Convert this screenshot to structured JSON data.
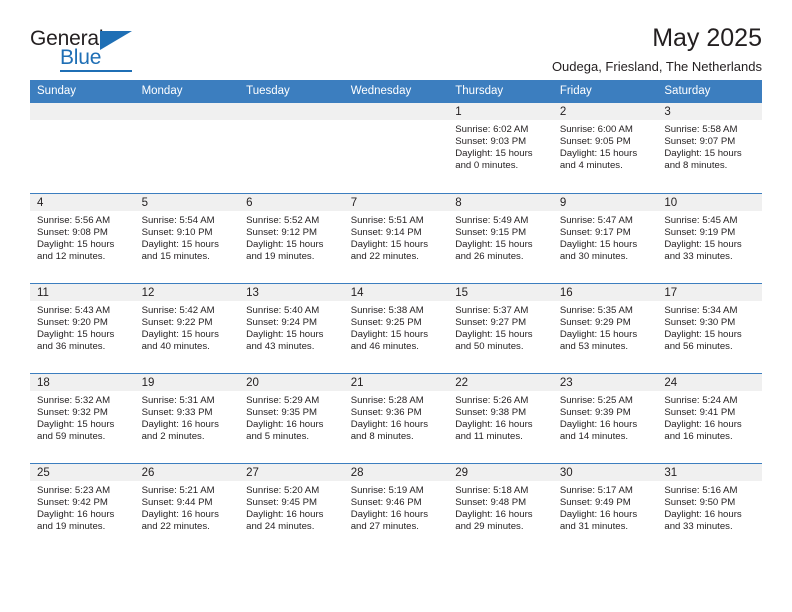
{
  "brand": {
    "name_top": "General",
    "name_bottom": "Blue",
    "accent_color": "#1f6fb5",
    "triangle_icon": "triangle-icon"
  },
  "header": {
    "title": "May 2025",
    "subtitle": "Oudega, Friesland, The Netherlands"
  },
  "calendar": {
    "header_background": "#3c7ebf",
    "daynum_background": "#f0f0f0",
    "weekday_headers": [
      "Sunday",
      "Monday",
      "Tuesday",
      "Wednesday",
      "Thursday",
      "Friday",
      "Saturday"
    ],
    "weeks": [
      [
        {
          "day": "",
          "sunrise": "",
          "sunset": "",
          "daylight_line1": "",
          "daylight_line2": ""
        },
        {
          "day": "",
          "sunrise": "",
          "sunset": "",
          "daylight_line1": "",
          "daylight_line2": ""
        },
        {
          "day": "",
          "sunrise": "",
          "sunset": "",
          "daylight_line1": "",
          "daylight_line2": ""
        },
        {
          "day": "",
          "sunrise": "",
          "sunset": "",
          "daylight_line1": "",
          "daylight_line2": ""
        },
        {
          "day": "1",
          "sunrise": "Sunrise: 6:02 AM",
          "sunset": "Sunset: 9:03 PM",
          "daylight_line1": "Daylight: 15 hours",
          "daylight_line2": "and 0 minutes."
        },
        {
          "day": "2",
          "sunrise": "Sunrise: 6:00 AM",
          "sunset": "Sunset: 9:05 PM",
          "daylight_line1": "Daylight: 15 hours",
          "daylight_line2": "and 4 minutes."
        },
        {
          "day": "3",
          "sunrise": "Sunrise: 5:58 AM",
          "sunset": "Sunset: 9:07 PM",
          "daylight_line1": "Daylight: 15 hours",
          "daylight_line2": "and 8 minutes."
        }
      ],
      [
        {
          "day": "4",
          "sunrise": "Sunrise: 5:56 AM",
          "sunset": "Sunset: 9:08 PM",
          "daylight_line1": "Daylight: 15 hours",
          "daylight_line2": "and 12 minutes."
        },
        {
          "day": "5",
          "sunrise": "Sunrise: 5:54 AM",
          "sunset": "Sunset: 9:10 PM",
          "daylight_line1": "Daylight: 15 hours",
          "daylight_line2": "and 15 minutes."
        },
        {
          "day": "6",
          "sunrise": "Sunrise: 5:52 AM",
          "sunset": "Sunset: 9:12 PM",
          "daylight_line1": "Daylight: 15 hours",
          "daylight_line2": "and 19 minutes."
        },
        {
          "day": "7",
          "sunrise": "Sunrise: 5:51 AM",
          "sunset": "Sunset: 9:14 PM",
          "daylight_line1": "Daylight: 15 hours",
          "daylight_line2": "and 22 minutes."
        },
        {
          "day": "8",
          "sunrise": "Sunrise: 5:49 AM",
          "sunset": "Sunset: 9:15 PM",
          "daylight_line1": "Daylight: 15 hours",
          "daylight_line2": "and 26 minutes."
        },
        {
          "day": "9",
          "sunrise": "Sunrise: 5:47 AM",
          "sunset": "Sunset: 9:17 PM",
          "daylight_line1": "Daylight: 15 hours",
          "daylight_line2": "and 30 minutes."
        },
        {
          "day": "10",
          "sunrise": "Sunrise: 5:45 AM",
          "sunset": "Sunset: 9:19 PM",
          "daylight_line1": "Daylight: 15 hours",
          "daylight_line2": "and 33 minutes."
        }
      ],
      [
        {
          "day": "11",
          "sunrise": "Sunrise: 5:43 AM",
          "sunset": "Sunset: 9:20 PM",
          "daylight_line1": "Daylight: 15 hours",
          "daylight_line2": "and 36 minutes."
        },
        {
          "day": "12",
          "sunrise": "Sunrise: 5:42 AM",
          "sunset": "Sunset: 9:22 PM",
          "daylight_line1": "Daylight: 15 hours",
          "daylight_line2": "and 40 minutes."
        },
        {
          "day": "13",
          "sunrise": "Sunrise: 5:40 AM",
          "sunset": "Sunset: 9:24 PM",
          "daylight_line1": "Daylight: 15 hours",
          "daylight_line2": "and 43 minutes."
        },
        {
          "day": "14",
          "sunrise": "Sunrise: 5:38 AM",
          "sunset": "Sunset: 9:25 PM",
          "daylight_line1": "Daylight: 15 hours",
          "daylight_line2": "and 46 minutes."
        },
        {
          "day": "15",
          "sunrise": "Sunrise: 5:37 AM",
          "sunset": "Sunset: 9:27 PM",
          "daylight_line1": "Daylight: 15 hours",
          "daylight_line2": "and 50 minutes."
        },
        {
          "day": "16",
          "sunrise": "Sunrise: 5:35 AM",
          "sunset": "Sunset: 9:29 PM",
          "daylight_line1": "Daylight: 15 hours",
          "daylight_line2": "and 53 minutes."
        },
        {
          "day": "17",
          "sunrise": "Sunrise: 5:34 AM",
          "sunset": "Sunset: 9:30 PM",
          "daylight_line1": "Daylight: 15 hours",
          "daylight_line2": "and 56 minutes."
        }
      ],
      [
        {
          "day": "18",
          "sunrise": "Sunrise: 5:32 AM",
          "sunset": "Sunset: 9:32 PM",
          "daylight_line1": "Daylight: 15 hours",
          "daylight_line2": "and 59 minutes."
        },
        {
          "day": "19",
          "sunrise": "Sunrise: 5:31 AM",
          "sunset": "Sunset: 9:33 PM",
          "daylight_line1": "Daylight: 16 hours",
          "daylight_line2": "and 2 minutes."
        },
        {
          "day": "20",
          "sunrise": "Sunrise: 5:29 AM",
          "sunset": "Sunset: 9:35 PM",
          "daylight_line1": "Daylight: 16 hours",
          "daylight_line2": "and 5 minutes."
        },
        {
          "day": "21",
          "sunrise": "Sunrise: 5:28 AM",
          "sunset": "Sunset: 9:36 PM",
          "daylight_line1": "Daylight: 16 hours",
          "daylight_line2": "and 8 minutes."
        },
        {
          "day": "22",
          "sunrise": "Sunrise: 5:26 AM",
          "sunset": "Sunset: 9:38 PM",
          "daylight_line1": "Daylight: 16 hours",
          "daylight_line2": "and 11 minutes."
        },
        {
          "day": "23",
          "sunrise": "Sunrise: 5:25 AM",
          "sunset": "Sunset: 9:39 PM",
          "daylight_line1": "Daylight: 16 hours",
          "daylight_line2": "and 14 minutes."
        },
        {
          "day": "24",
          "sunrise": "Sunrise: 5:24 AM",
          "sunset": "Sunset: 9:41 PM",
          "daylight_line1": "Daylight: 16 hours",
          "daylight_line2": "and 16 minutes."
        }
      ],
      [
        {
          "day": "25",
          "sunrise": "Sunrise: 5:23 AM",
          "sunset": "Sunset: 9:42 PM",
          "daylight_line1": "Daylight: 16 hours",
          "daylight_line2": "and 19 minutes."
        },
        {
          "day": "26",
          "sunrise": "Sunrise: 5:21 AM",
          "sunset": "Sunset: 9:44 PM",
          "daylight_line1": "Daylight: 16 hours",
          "daylight_line2": "and 22 minutes."
        },
        {
          "day": "27",
          "sunrise": "Sunrise: 5:20 AM",
          "sunset": "Sunset: 9:45 PM",
          "daylight_line1": "Daylight: 16 hours",
          "daylight_line2": "and 24 minutes."
        },
        {
          "day": "28",
          "sunrise": "Sunrise: 5:19 AM",
          "sunset": "Sunset: 9:46 PM",
          "daylight_line1": "Daylight: 16 hours",
          "daylight_line2": "and 27 minutes."
        },
        {
          "day": "29",
          "sunrise": "Sunrise: 5:18 AM",
          "sunset": "Sunset: 9:48 PM",
          "daylight_line1": "Daylight: 16 hours",
          "daylight_line2": "and 29 minutes."
        },
        {
          "day": "30",
          "sunrise": "Sunrise: 5:17 AM",
          "sunset": "Sunset: 9:49 PM",
          "daylight_line1": "Daylight: 16 hours",
          "daylight_line2": "and 31 minutes."
        },
        {
          "day": "31",
          "sunrise": "Sunrise: 5:16 AM",
          "sunset": "Sunset: 9:50 PM",
          "daylight_line1": "Daylight: 16 hours",
          "daylight_line2": "and 33 minutes."
        }
      ]
    ]
  }
}
